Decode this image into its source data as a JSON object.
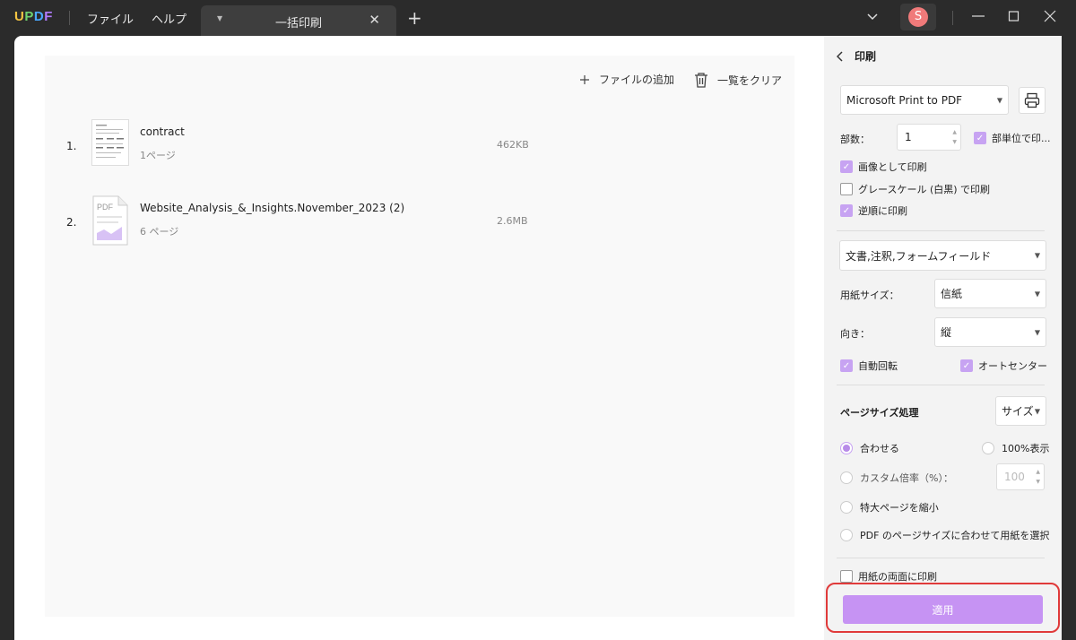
{
  "titlebar": {
    "logo": {
      "u": "U",
      "p": "P",
      "d": "D",
      "f": "F"
    },
    "menu_file": "ファイル",
    "menu_help": "ヘルプ",
    "tab_title": "一括印刷",
    "avatar_letter": "S"
  },
  "toolbar": {
    "add_file": "ファイルの追加",
    "clear_list": "一覧をクリア"
  },
  "files": [
    {
      "num": "1.",
      "name": "contract",
      "pages": "1ページ",
      "size": "462KB"
    },
    {
      "num": "2.",
      "name": "Website_Analysis_&_Insights.November_2023 (2)",
      "pages": "6 ページ",
      "size": "2.6MB",
      "thumb_label": "PDF"
    }
  ],
  "panel": {
    "title": "印刷",
    "printer": "Microsoft Print to PDF",
    "copies_label": "部数：",
    "copies_value": "1",
    "collate_label": "部単位で印...",
    "print_as_image": "画像として印刷",
    "grayscale": "グレースケール (白黒) で印刷",
    "reverse": "逆順に印刷",
    "content_select": "文書,注釈,フォームフィールド",
    "paper_size_label": "用紙サイズ：",
    "paper_size_value": "信紙",
    "orientation_label": "向き：",
    "orientation_value": "縦",
    "auto_rotate": "自動回転",
    "auto_center": "オートセンター",
    "page_size_handling": "ページサイズ処理",
    "page_size_select": "サイズ",
    "fit": "合わせる",
    "actual_size": "100%表示",
    "custom_scale": "カスタム倍率（%）：",
    "custom_scale_value": "100",
    "shrink_oversized": "特大ページを縮小",
    "choose_paper": "PDF のページサイズに合わせて用紙を選択",
    "duplex": "用紙の両面に印刷",
    "apply": "適用"
  },
  "colors": {
    "accent": "#c693f3",
    "highlight_border": "#e03a3a"
  }
}
